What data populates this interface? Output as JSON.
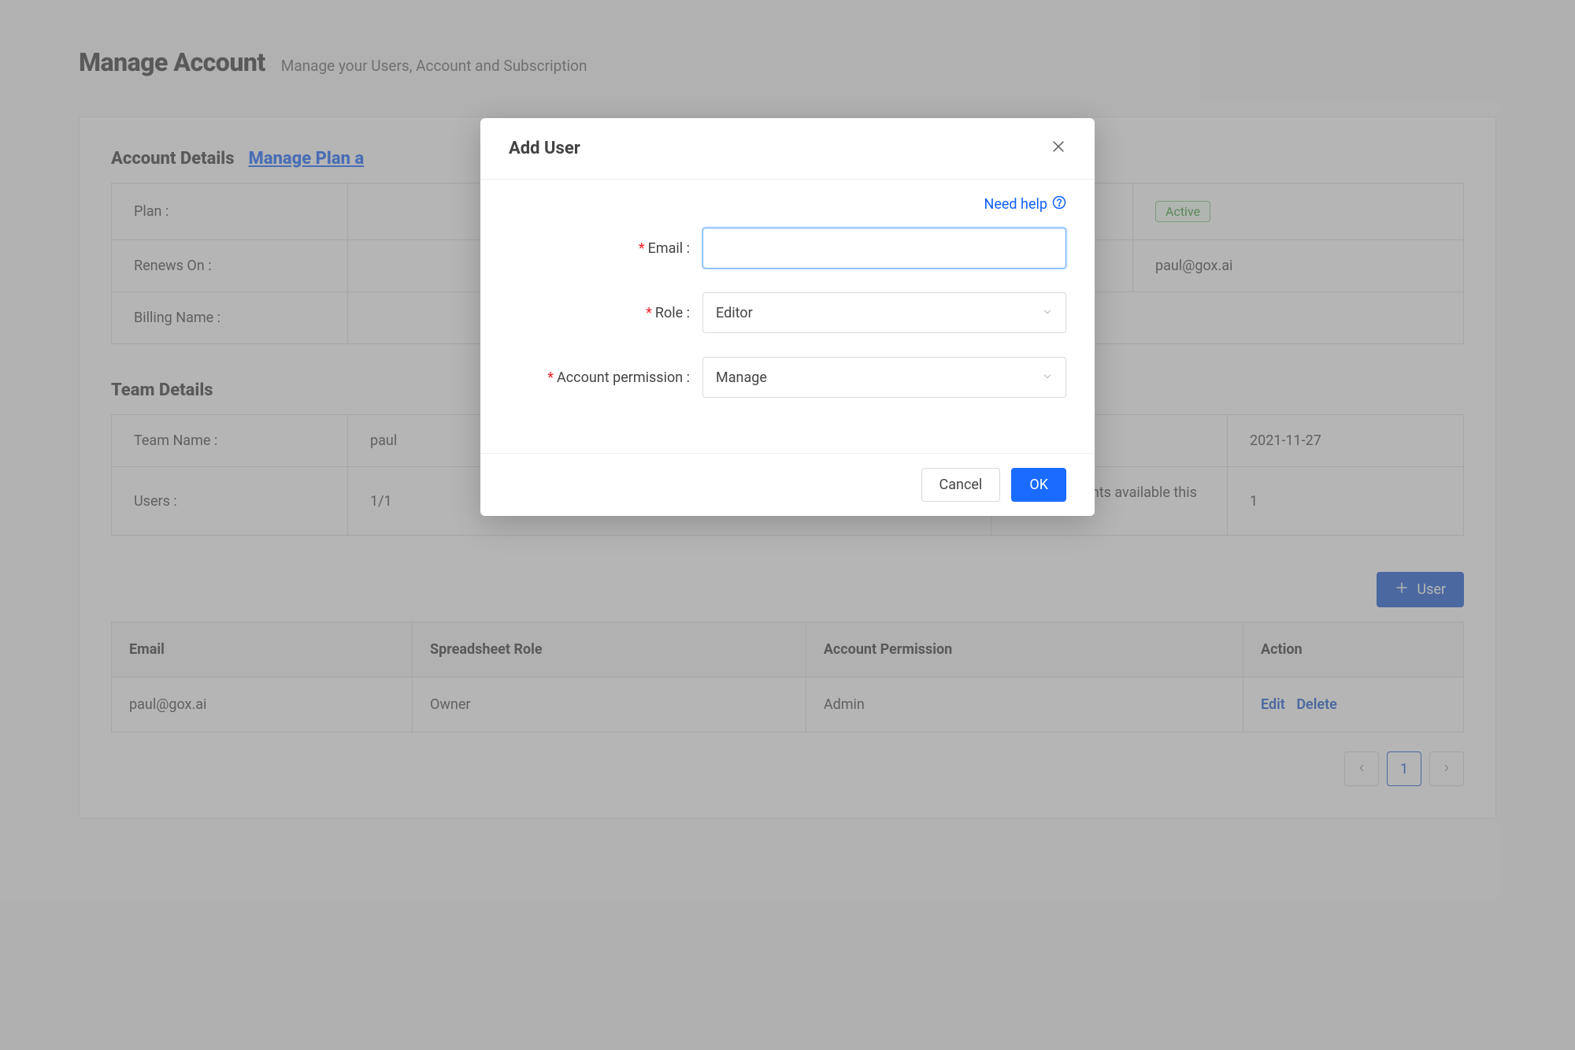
{
  "header": {
    "title": "Manage Account",
    "subtitle": "Manage your Users, Account and Subscription"
  },
  "account_details": {
    "heading": "Account Details",
    "manage_link": "Manage Plan a",
    "rows": {
      "plan_label": "Plan :",
      "plan_value": "",
      "status_badge": "Active",
      "renews_label": "Renews On :",
      "renews_value": "",
      "contact_value": "paul@gox.ai",
      "billing_label": "Billing Name :",
      "billing_value": ""
    }
  },
  "team_details": {
    "heading": "Team Details",
    "rows": {
      "team_name_label": "Team Name :",
      "team_name_value": "paul",
      "date_value": "2021-11-27",
      "users_label": "Users :",
      "users_value": "1/1",
      "reassign_label": "Reassignments available this month :",
      "reassign_value": "1"
    }
  },
  "add_user_button": "User",
  "users_table": {
    "headers": {
      "email": "Email",
      "role": "Spreadsheet Role",
      "permission": "Account Permission",
      "action": "Action"
    },
    "rows": [
      {
        "email": "paul@gox.ai",
        "role": "Owner",
        "permission": "Admin",
        "edit": "Edit",
        "delete": "Delete"
      }
    ]
  },
  "pagination": {
    "current": "1"
  },
  "modal": {
    "title": "Add User",
    "help": "Need help",
    "email_label": "Email",
    "role_label": "Role",
    "role_value": "Editor",
    "permission_label": "Account permission",
    "permission_value": "Manage",
    "cancel": "Cancel",
    "ok": "OK"
  }
}
